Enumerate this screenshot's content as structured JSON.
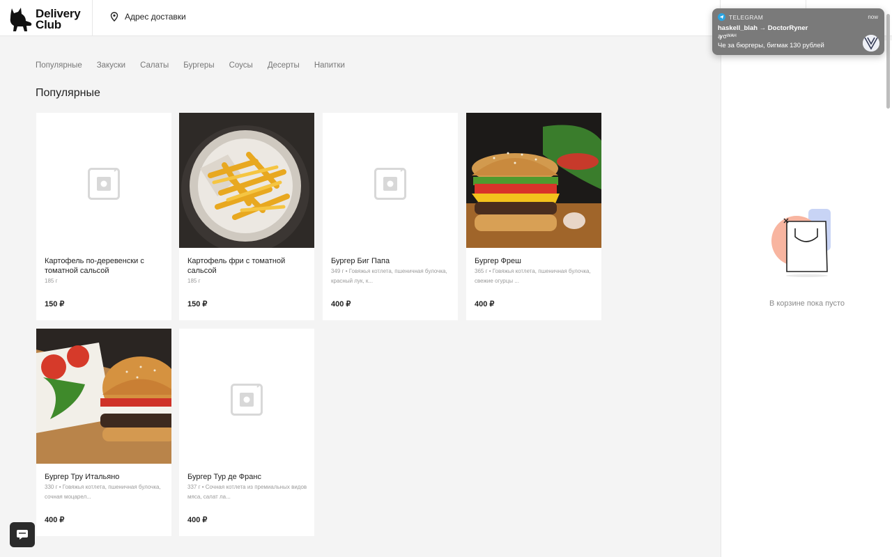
{
  "header": {
    "brand_line1": "Delivery",
    "brand_line2": "Club",
    "address_label": "Адрес доставки"
  },
  "notification": {
    "app": "TELEGRAM",
    "time": "now",
    "title": "haskell_blah → DoctorRyner",
    "subtitle": "ꜽσᵂᴬᴴ",
    "message": "Че за бюргеры, бигмак 130 рублей"
  },
  "categories": [
    "Популярные",
    "Закуски",
    "Салаты",
    "Бургеры",
    "Соусы",
    "Десерты",
    "Напитки"
  ],
  "section_title": "Популярные",
  "products": [
    {
      "name": "Картофель по-деревенски с томатной сальсой",
      "weight": "185 г",
      "desc": "",
      "price": "150 ₽"
    },
    {
      "name": "Картофель фри с томатной сальсой",
      "weight": "185 г",
      "desc": "",
      "price": "150 ₽"
    },
    {
      "name": "Бургер Биг Папа",
      "weight": "349 г",
      "desc": "Говяжья котлета, пшеничная булочка, красный лук, к...",
      "price": "400 ₽"
    },
    {
      "name": "Бургер Фреш",
      "weight": "365 г",
      "desc": "Говяжья котлета, пшеничная булочка, свежие огурцы ...",
      "price": "400 ₽"
    },
    {
      "name": "Бургер Тру Итальяно",
      "weight": "330 г",
      "desc": "Говяжья котлета, пшеничная булочка, сочная моцарел...",
      "price": "400 ₽"
    },
    {
      "name": "Бургер Тур де Франс",
      "weight": "337 г",
      "desc": "Сочная котлета из премиальных видов мяса, салат ла...",
      "price": "400 ₽"
    }
  ],
  "cart": {
    "empty_text": "В корзине пока пусто"
  }
}
